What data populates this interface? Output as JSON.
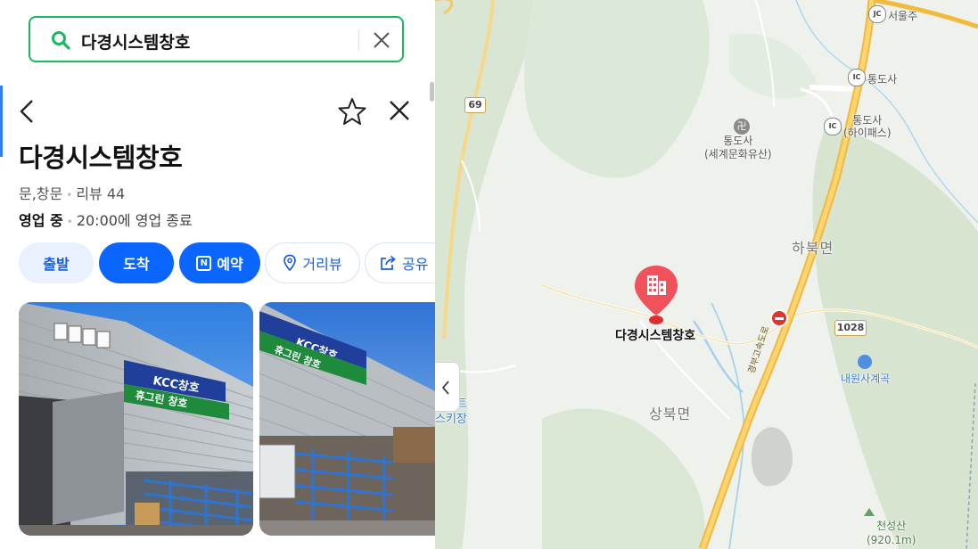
{
  "search": {
    "query": "다경시스템창호"
  },
  "place": {
    "name": "다경시스템창호",
    "category": "문,창문",
    "reviews": "리뷰 44",
    "status": "영업 중",
    "hours": "20:00에 영업 종료"
  },
  "actions": {
    "depart": "출발",
    "arrive": "도착",
    "reserve": "예약",
    "reserve_badge": "N",
    "streetview": "거리뷰",
    "share": "공유"
  },
  "photos": [
    {
      "sign_main": "KCC창호",
      "sign_sub": "휴그린 창호"
    },
    {
      "sign_main": "KCC창호",
      "sign_sub": "휴그린 창호"
    }
  ],
  "map": {
    "marker_label": "다경시스템창호",
    "road_69": "69",
    "road_1028": "1028",
    "jc_label": "서울주",
    "ic1_label": "통도사",
    "ic2_label": "통도사",
    "ic2_sub": "(하이패스)",
    "temple_label": "통도사",
    "temple_sub": "(세계문화유산)",
    "district1": "하북면",
    "district2": "상북면",
    "valley": "내원사계곡",
    "resort1": "리조트",
    "resort2": "스키장",
    "mountain": "천성산",
    "mountain_height": "(920.1m)",
    "highway_name": "경부고속도로",
    "jc_badge": "JC",
    "ic_badge": "IC"
  },
  "colors": {
    "accent": "#0a66ff",
    "search_border": "#19b85f",
    "marker": "#f0515b",
    "highway": "#f5c15a"
  }
}
